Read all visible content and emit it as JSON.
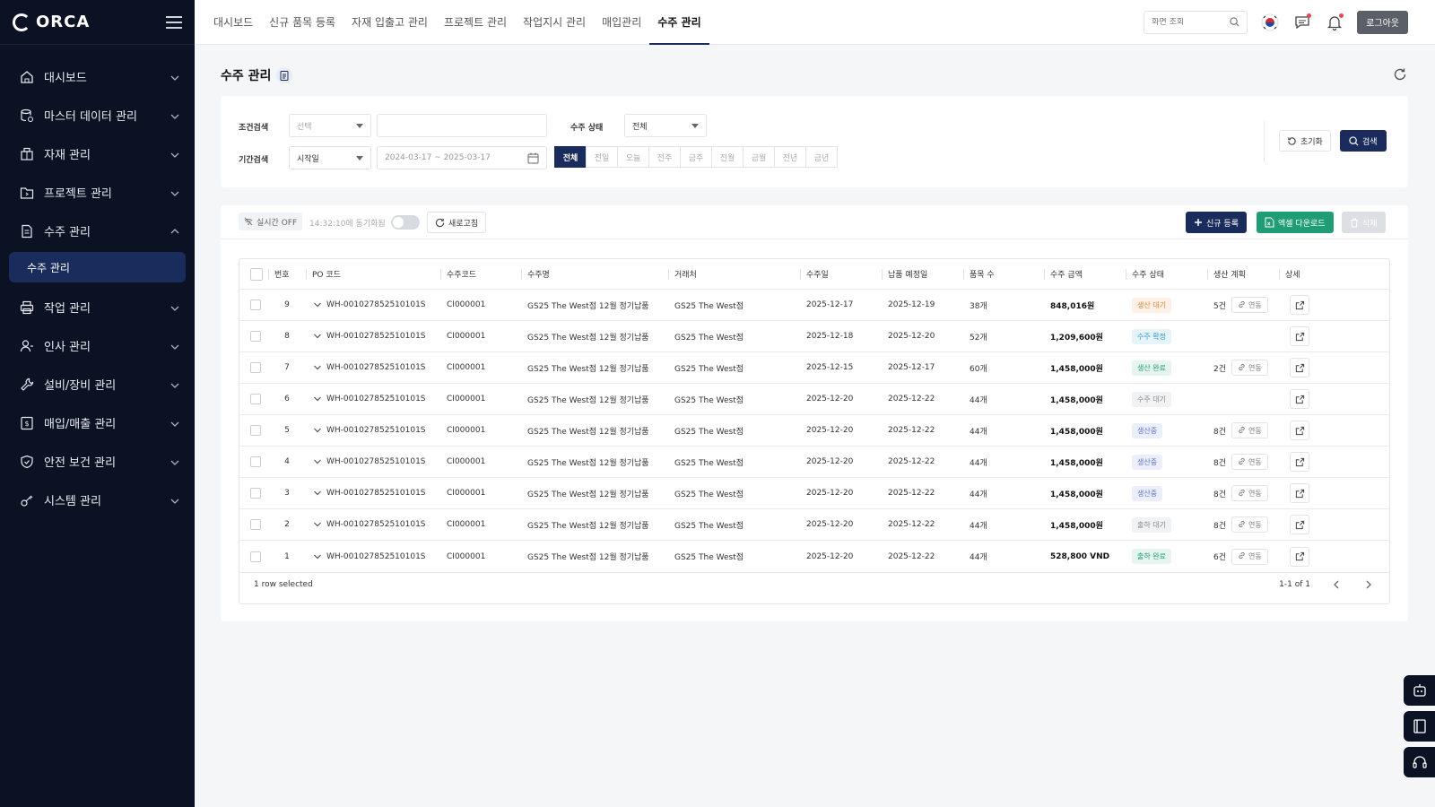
{
  "app": {
    "logo_text": "ORCA"
  },
  "sidebar": {
    "items": [
      {
        "label": "대시보드",
        "icon": "home-icon",
        "expanded": false
      },
      {
        "label": "마스터 데이터 관리",
        "icon": "database-icon",
        "expanded": false
      },
      {
        "label": "자재 관리",
        "icon": "box-icon",
        "expanded": false
      },
      {
        "label": "프로젝트 관리",
        "icon": "folder-icon",
        "expanded": false
      },
      {
        "label": "수주 관리",
        "icon": "document-icon",
        "expanded": true
      },
      {
        "label": "작업 관리",
        "icon": "printer-icon",
        "expanded": false
      },
      {
        "label": "인사 관리",
        "icon": "user-icon",
        "expanded": false
      },
      {
        "label": "설비/장비 관리",
        "icon": "wrench-icon",
        "expanded": false
      },
      {
        "label": "매입/매출 관리",
        "icon": "receipt-icon",
        "expanded": false
      },
      {
        "label": "안전 보건 관리",
        "icon": "shield-icon",
        "expanded": false
      },
      {
        "label": "시스템 관리",
        "icon": "key-icon",
        "expanded": false
      }
    ],
    "active_sub": "수주 관리"
  },
  "topbar": {
    "tabs": [
      "대시보드",
      "신규 품목 등록",
      "자재 입출고 관리",
      "프로젝트 관리",
      "작업지시 관리",
      "매입관리",
      "수주 관리"
    ],
    "active_tab": "수주 관리",
    "search_placeholder": "화면 조회",
    "logout_label": "로그아웃"
  },
  "page": {
    "title": "수주 관리"
  },
  "filters": {
    "condition_label": "조건검색",
    "condition_select": "선택",
    "condition_input": "",
    "status_label": "수주 상태",
    "status_select": "전체",
    "period_label": "기간검색",
    "period_select": "시작일",
    "date_range": "2024-03-17 ~ 2025-03-17",
    "period_buttons": [
      "전체",
      "전일",
      "오늘",
      "전주",
      "금주",
      "전월",
      "금월",
      "전년",
      "금년"
    ],
    "period_active": "전체",
    "reset_label": "초기화",
    "search_label": "검색"
  },
  "toolbar": {
    "live_label": "실시간 OFF",
    "sync_text": "14:32:10에 동기화됨",
    "refresh_label": "새로고침",
    "new_label": "신규 등록",
    "excel_label": "엑셀 다운로드",
    "delete_label": "삭제"
  },
  "table": {
    "columns": [
      "번호",
      "PO 코드",
      "수주코드",
      "수주명",
      "거래처",
      "수주일",
      "납품 예정일",
      "품목 수",
      "수주 금액",
      "수주 상태",
      "생산 계획",
      "상세"
    ],
    "rows": [
      {
        "no": "9",
        "po": "WH-001027852510101S",
        "code": "CI000001",
        "name": "GS25 The West점 12월 정기납품",
        "client": "GS25 The West점",
        "order_date": "2025-12-17",
        "due_date": "2025-12-19",
        "items": "38개",
        "amount": "848,016원",
        "status": "생산 대기",
        "status_color": "#e8833a",
        "status_bg": "#fdf1e7",
        "plan": "5건",
        "link_label": "연동"
      },
      {
        "no": "8",
        "po": "WH-001027852510101S",
        "code": "CI000001",
        "name": "GS25 The West점 12월 정기납품",
        "client": "GS25 The West점",
        "order_date": "2025-12-18",
        "due_date": "2025-12-20",
        "items": "52개",
        "amount": "1,209,600원",
        "status": "수주 확정",
        "status_color": "#2a9bd6",
        "status_bg": "#e7f4fb",
        "plan": "",
        "link_label": ""
      },
      {
        "no": "7",
        "po": "WH-001027852510101S",
        "code": "CI000001",
        "name": "GS25 The West점 12월 정기납품",
        "client": "GS25 The West점",
        "order_date": "2025-12-15",
        "due_date": "2025-12-17",
        "items": "60개",
        "amount": "1,458,000원",
        "status": "생산 완료",
        "status_color": "#1f9d74",
        "status_bg": "#e6f5ef",
        "plan": "2건",
        "link_label": "연동"
      },
      {
        "no": "6",
        "po": "WH-001027852510101S",
        "code": "CI000001",
        "name": "GS25 The West점 12월 정기납품",
        "client": "GS25 The West점",
        "order_date": "2025-12-20",
        "due_date": "2025-12-22",
        "items": "44개",
        "amount": "1,458,000원",
        "status": "수주 대기",
        "status_color": "#888888",
        "status_bg": "#f1f2f4",
        "plan": "",
        "link_label": ""
      },
      {
        "no": "5",
        "po": "WH-001027852510101S",
        "code": "CI000001",
        "name": "GS25 The West점 12월 정기납품",
        "client": "GS25 The West점",
        "order_date": "2025-12-20",
        "due_date": "2025-12-22",
        "items": "44개",
        "amount": "1,458,000원",
        "status": "생산중",
        "status_color": "#5b6fd6",
        "status_bg": "#eceffb",
        "plan": "8건",
        "link_label": "연동"
      },
      {
        "no": "4",
        "po": "WH-001027852510101S",
        "code": "CI000001",
        "name": "GS25 The West점 12월 정기납품",
        "client": "GS25 The West점",
        "order_date": "2025-12-20",
        "due_date": "2025-12-22",
        "items": "44개",
        "amount": "1,458,000원",
        "status": "생산중",
        "status_color": "#5b6fd6",
        "status_bg": "#eceffb",
        "plan": "8건",
        "link_label": "연동"
      },
      {
        "no": "3",
        "po": "WH-001027852510101S",
        "code": "CI000001",
        "name": "GS25 The West점 12월 정기납품",
        "client": "GS25 The West점",
        "order_date": "2025-12-20",
        "due_date": "2025-12-22",
        "items": "44개",
        "amount": "1,458,000원",
        "status": "생산중",
        "status_color": "#5b6fd6",
        "status_bg": "#eceffb",
        "plan": "8건",
        "link_label": "연동"
      },
      {
        "no": "2",
        "po": "WH-001027852510101S",
        "code": "CI000001",
        "name": "GS25 The West점 12월 정기납품",
        "client": "GS25 The West점",
        "order_date": "2025-12-20",
        "due_date": "2025-12-22",
        "items": "44개",
        "amount": "1,458,000원",
        "status": "출하 대기",
        "status_color": "#888888",
        "status_bg": "#f1f2f4",
        "plan": "8건",
        "link_label": "연동"
      },
      {
        "no": "1",
        "po": "WH-001027852510101S",
        "code": "CI000001",
        "name": "GS25 The West점 12월 정기납품",
        "client": "GS25 The West점",
        "order_date": "2025-12-20",
        "due_date": "2025-12-22",
        "items": "44개",
        "amount": "528,800 VND",
        "status": "출하 완료",
        "status_color": "#1f9d74",
        "status_bg": "#e6f5ef",
        "plan": "6건",
        "link_label": "연동"
      }
    ]
  },
  "footer": {
    "selected_text": "1 row selected",
    "page_text": "1-1 of 1"
  },
  "colors": {
    "sidebar_bg": "#0b1224",
    "accent": "#1a2c5b",
    "excel_green": "#1f9d74"
  }
}
